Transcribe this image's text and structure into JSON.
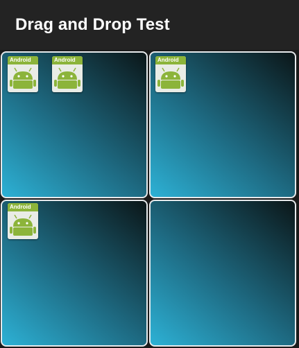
{
  "app": {
    "title": "Drag and Drop Test"
  },
  "grid": {
    "cells": [
      {
        "items": [
          {
            "label": "Android"
          },
          {
            "label": "Android"
          }
        ]
      },
      {
        "items": [
          {
            "label": "Android"
          }
        ]
      },
      {
        "items": [
          {
            "label": "Android"
          }
        ]
      },
      {
        "items": []
      }
    ]
  },
  "colors": {
    "toolbar": "#232323",
    "cell_border": "#e7eaec",
    "gradient_light": "#2db1d5",
    "gradient_dark": "#0b1618",
    "android_green": "#8cb43a"
  },
  "icons": {
    "drag_item": "android-icon"
  }
}
